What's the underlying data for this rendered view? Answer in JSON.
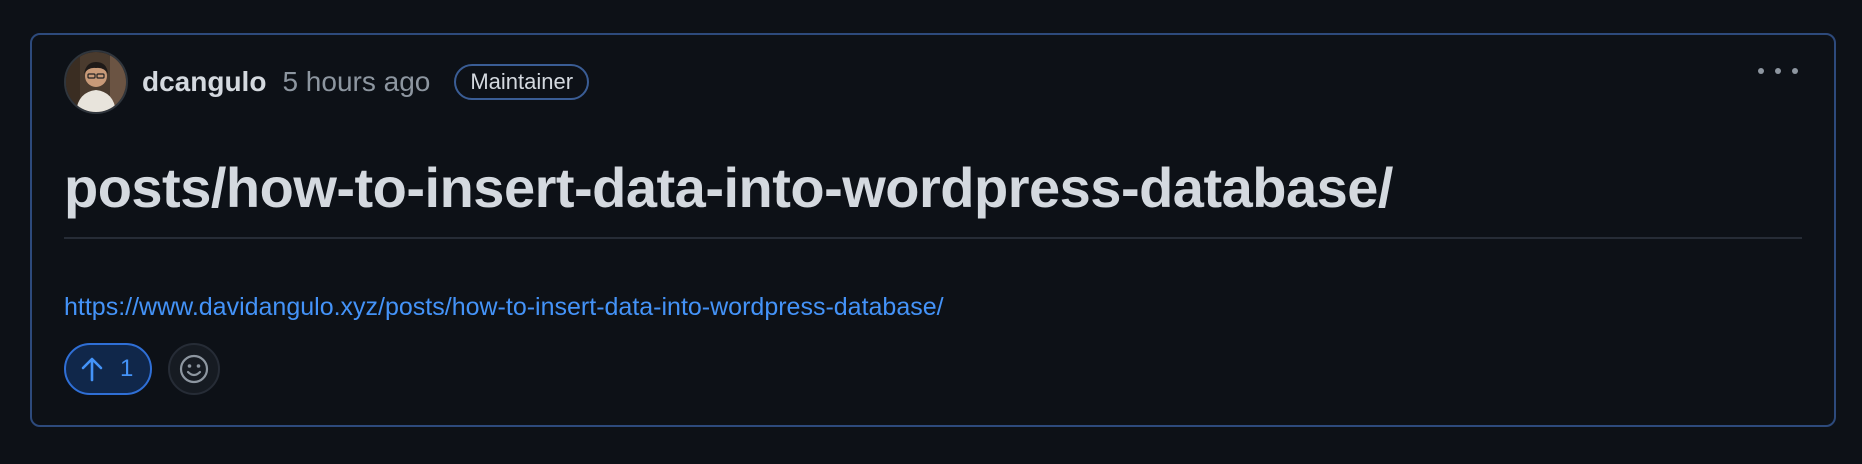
{
  "comment": {
    "author": "dcangulo",
    "time": "5 hours ago",
    "badge": "Maintainer",
    "title": "posts/how-to-insert-data-into-wordpress-database/",
    "link": "https://www.davidangulo.xyz/posts/how-to-insert-data-into-wordpress-database/",
    "upvote_count": "1"
  },
  "icons": {
    "avatar": "user-avatar",
    "more": "kebab-horizontal-icon",
    "upvote": "arrow-up-icon",
    "emoji": "smiley-icon"
  },
  "colors": {
    "background": "#0d1117",
    "border": "#2d4a7c",
    "text": "#d4d9df",
    "muted": "#8d96a0",
    "link": "#4493f8"
  }
}
